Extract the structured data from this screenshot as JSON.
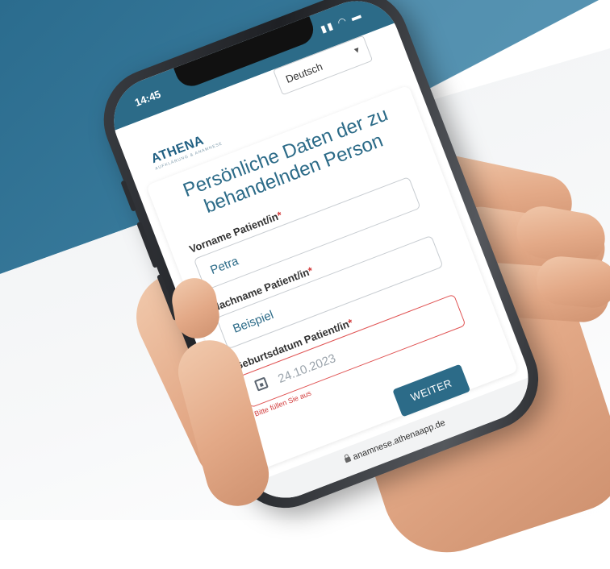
{
  "status_bar": {
    "time": "14:45",
    "icons": "▮▮ ◠ ▬"
  },
  "header": {
    "language": "Deutsch"
  },
  "logo": {
    "name": "ATHENA",
    "subtitle": "AUFKLÄRUNG & ANAMNESE"
  },
  "form": {
    "title": "Persönliche Daten der zu behandelnden Person",
    "first_name": {
      "label": "Vorname Patient/in",
      "required_mark": "*",
      "value": "Petra"
    },
    "last_name": {
      "label": "Nachname Patient/in",
      "required_mark": "*",
      "value": "Beispiel"
    },
    "birth_date": {
      "label": "Geburtsdatum Patient/in",
      "required_mark": "*",
      "value": "24.10.2023",
      "error": "Bitte füllen Sie aus"
    },
    "next_label": "WEITER"
  },
  "url_bar": {
    "url": "anamnese.athenaapp.de"
  },
  "colors": {
    "accent": "#2c6b88",
    "error": "#d23a3a",
    "background_teal": "#2b6c8e"
  }
}
